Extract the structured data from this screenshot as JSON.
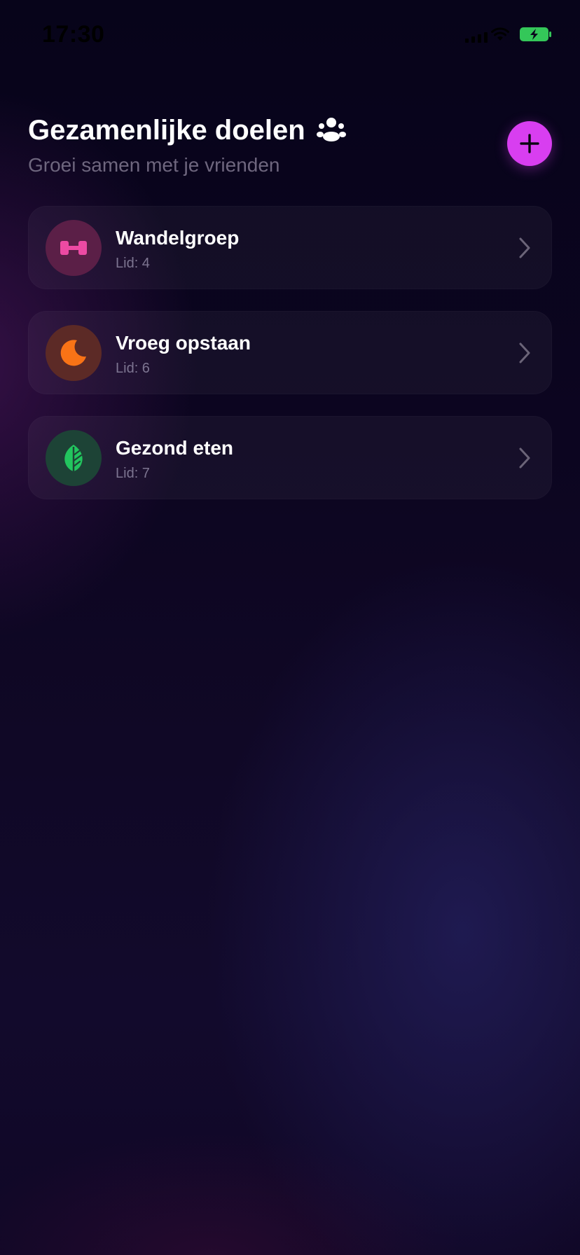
{
  "status_bar": {
    "time": "17:30",
    "battery_color": "#34c759",
    "icons": [
      "cellular-signal-icon",
      "wifi-icon",
      "battery-charging-icon"
    ]
  },
  "header": {
    "title": "Gezamenlijke doelen",
    "title_icon": "users-group-icon",
    "subtitle": "Groei samen met je vrienden",
    "add_button_icon": "plus-icon",
    "accent_color": "#d83ef0"
  },
  "goals": [
    {
      "name": "Wandelgroep",
      "members": "Lid: 4",
      "icon": "dumbbell-icon",
      "icon_color": "#ec4aa3",
      "avatar_color": "#5b1f47"
    },
    {
      "name": "Vroeg opstaan",
      "members": "Lid: 6",
      "icon": "moon-icon",
      "icon_color": "#f97316",
      "avatar_color": "#5c2a26"
    },
    {
      "name": "Gezond eten",
      "members": "Lid: 7",
      "icon": "leaf-icon",
      "icon_color": "#22c55e",
      "avatar_color": "#1d4336"
    }
  ]
}
